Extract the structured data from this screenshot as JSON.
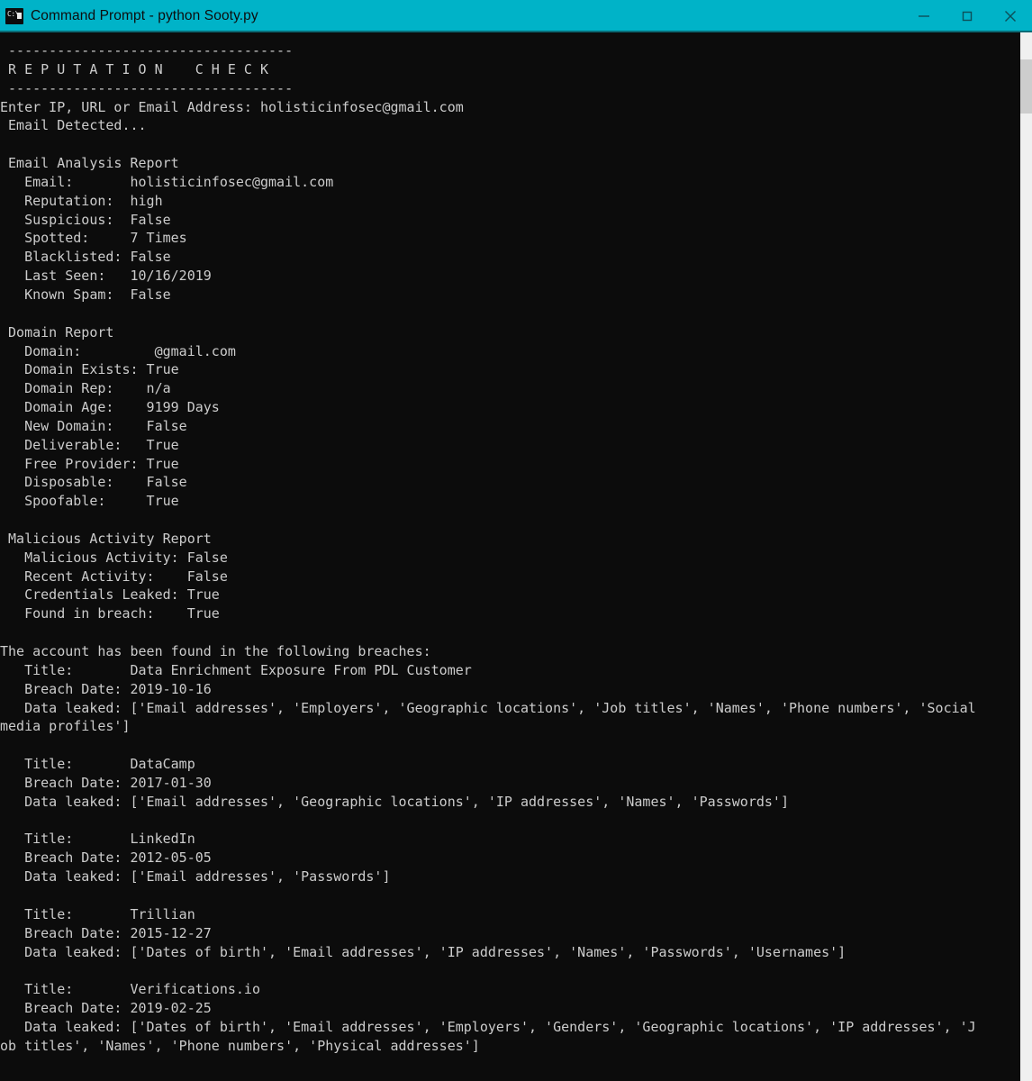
{
  "window": {
    "title": "Command Prompt - python  Sooty.py",
    "app_icon": "command-prompt-icon",
    "icon_glyph": "C:\\",
    "titlebar_color": "#00b3c8",
    "background_color": "#0c0c0c",
    "text_color": "#cccccc",
    "controls": {
      "minimize_label": "Minimize",
      "maximize_label": "Maximize",
      "close_label": "Close"
    }
  },
  "scrollbar": {
    "thumb_position": "top",
    "track_color": "#f0f0f0",
    "thumb_color": "#cdcdcd"
  },
  "console": {
    "lines": [
      " -----------------------------------",
      " R E P U T A T I O N    C H E C K",
      " -----------------------------------",
      "Enter IP, URL or Email Address: holisticinfosec@gmail.com",
      " Email Detected...",
      "",
      " Email Analysis Report",
      "   Email:       holisticinfosec@gmail.com",
      "   Reputation:  high",
      "   Suspicious:  False",
      "   Spotted:     7 Times",
      "   Blacklisted: False",
      "   Last Seen:   10/16/2019",
      "   Known Spam:  False",
      "",
      " Domain Report",
      "   Domain:         @gmail.com",
      "   Domain Exists: True",
      "   Domain Rep:    n/a",
      "   Domain Age:    9199 Days",
      "   New Domain:    False",
      "   Deliverable:   True",
      "   Free Provider: True",
      "   Disposable:    False",
      "   Spoofable:     True",
      "",
      " Malicious Activity Report",
      "   Malicious Activity: False",
      "   Recent Activity:    False",
      "   Credentials Leaked: True",
      "   Found in breach:    True",
      "",
      "The account has been found in the following breaches:",
      "   Title:       Data Enrichment Exposure From PDL Customer",
      "   Breach Date: 2019-10-16",
      "   Data leaked: ['Email addresses', 'Employers', 'Geographic locations', 'Job titles', 'Names', 'Phone numbers', 'Social",
      "media profiles']",
      "",
      "   Title:       DataCamp",
      "   Breach Date: 2017-01-30",
      "   Data leaked: ['Email addresses', 'Geographic locations', 'IP addresses', 'Names', 'Passwords']",
      "",
      "   Title:       LinkedIn",
      "   Breach Date: 2012-05-05",
      "   Data leaked: ['Email addresses', 'Passwords']",
      "",
      "   Title:       Trillian",
      "   Breach Date: 2015-12-27",
      "   Data leaked: ['Dates of birth', 'Email addresses', 'IP addresses', 'Names', 'Passwords', 'Usernames']",
      "",
      "   Title:       Verifications.io",
      "   Breach Date: 2019-02-25",
      "   Data leaked: ['Dates of birth', 'Email addresses', 'Employers', 'Genders', 'Geographic locations', 'IP addresses', 'J",
      "ob titles', 'Names', 'Phone numbers', 'Physical addresses']"
    ]
  }
}
